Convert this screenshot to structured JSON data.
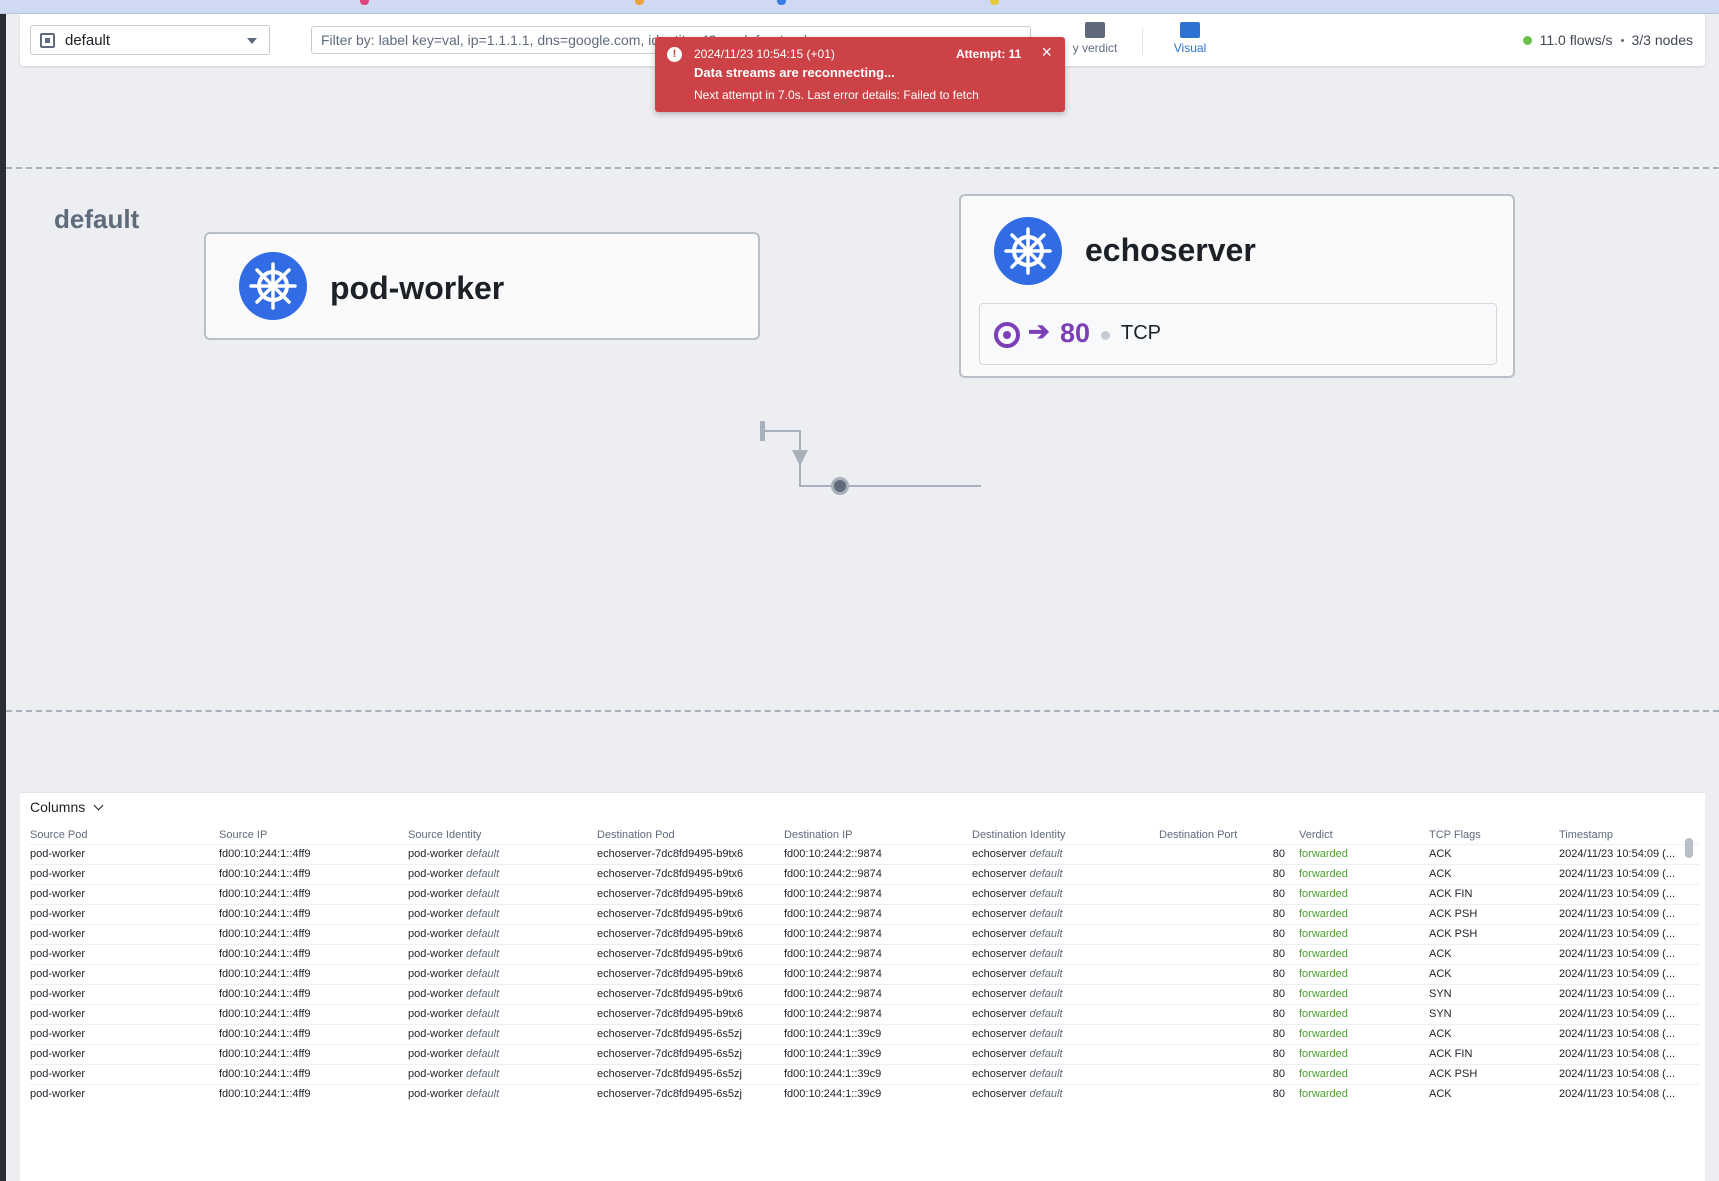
{
  "namespace_select": {
    "value": "default"
  },
  "filter": {
    "placeholder": "Filter by: label key=val, ip=1.1.1.1, dns=google.com, identity=42, pod=frontend"
  },
  "toolbar": {
    "verdict_label": "y verdict",
    "visual_label": "Visual"
  },
  "stats": {
    "flows": "11.0 flows/s",
    "nodes": "3/3 nodes"
  },
  "toast": {
    "timestamp": "2024/11/23 10:54:15 (+01)",
    "attempt": "Attempt: 11",
    "title": "Data streams are reconnecting...",
    "detail": "Next attempt in 7.0s. Last error details: Failed to fetch",
    "close": "×",
    "color": "#cd4246"
  },
  "canvas": {
    "namespace_title": "default",
    "source_card": {
      "name": "pod-worker",
      "icon": "kubernetes-icon"
    },
    "dest_card": {
      "name": "echoserver",
      "icon": "kubernetes-icon",
      "port": "80",
      "arrow": "➔",
      "protocol": "TCP",
      "accent": "#7c3fb8"
    }
  },
  "flows": {
    "columns_button": "Columns",
    "headers": [
      "Source Pod",
      "Source IP",
      "Source Identity",
      "Destination Pod",
      "Destination IP",
      "Destination Identity",
      "Destination Port",
      "Verdict",
      "TCP Flags",
      "Timestamp"
    ],
    "rows": [
      {
        "src_pod": "pod-worker",
        "src_ip": "fd00:10:244:1::4ff9",
        "src_id": "pod-worker",
        "src_ns": "default",
        "dst_pod": "echoserver-7dc8fd9495-b9tx6",
        "dst_ip": "fd00:10:244:2::9874",
        "dst_id": "echoserver",
        "dst_ns": "default",
        "port": "80",
        "verdict": "forwarded",
        "flags": "ACK",
        "ts": "2024/11/23 10:54:09 (..."
      },
      {
        "src_pod": "pod-worker",
        "src_ip": "fd00:10:244:1::4ff9",
        "src_id": "pod-worker",
        "src_ns": "default",
        "dst_pod": "echoserver-7dc8fd9495-b9tx6",
        "dst_ip": "fd00:10:244:2::9874",
        "dst_id": "echoserver",
        "dst_ns": "default",
        "port": "80",
        "verdict": "forwarded",
        "flags": "ACK",
        "ts": "2024/11/23 10:54:09 (..."
      },
      {
        "src_pod": "pod-worker",
        "src_ip": "fd00:10:244:1::4ff9",
        "src_id": "pod-worker",
        "src_ns": "default",
        "dst_pod": "echoserver-7dc8fd9495-b9tx6",
        "dst_ip": "fd00:10:244:2::9874",
        "dst_id": "echoserver",
        "dst_ns": "default",
        "port": "80",
        "verdict": "forwarded",
        "flags": "ACK FIN",
        "ts": "2024/11/23 10:54:09 (..."
      },
      {
        "src_pod": "pod-worker",
        "src_ip": "fd00:10:244:1::4ff9",
        "src_id": "pod-worker",
        "src_ns": "default",
        "dst_pod": "echoserver-7dc8fd9495-b9tx6",
        "dst_ip": "fd00:10:244:2::9874",
        "dst_id": "echoserver",
        "dst_ns": "default",
        "port": "80",
        "verdict": "forwarded",
        "flags": "ACK PSH",
        "ts": "2024/11/23 10:54:09 (..."
      },
      {
        "src_pod": "pod-worker",
        "src_ip": "fd00:10:244:1::4ff9",
        "src_id": "pod-worker",
        "src_ns": "default",
        "dst_pod": "echoserver-7dc8fd9495-b9tx6",
        "dst_ip": "fd00:10:244:2::9874",
        "dst_id": "echoserver",
        "dst_ns": "default",
        "port": "80",
        "verdict": "forwarded",
        "flags": "ACK PSH",
        "ts": "2024/11/23 10:54:09 (..."
      },
      {
        "src_pod": "pod-worker",
        "src_ip": "fd00:10:244:1::4ff9",
        "src_id": "pod-worker",
        "src_ns": "default",
        "dst_pod": "echoserver-7dc8fd9495-b9tx6",
        "dst_ip": "fd00:10:244:2::9874",
        "dst_id": "echoserver",
        "dst_ns": "default",
        "port": "80",
        "verdict": "forwarded",
        "flags": "ACK",
        "ts": "2024/11/23 10:54:09 (..."
      },
      {
        "src_pod": "pod-worker",
        "src_ip": "fd00:10:244:1::4ff9",
        "src_id": "pod-worker",
        "src_ns": "default",
        "dst_pod": "echoserver-7dc8fd9495-b9tx6",
        "dst_ip": "fd00:10:244:2::9874",
        "dst_id": "echoserver",
        "dst_ns": "default",
        "port": "80",
        "verdict": "forwarded",
        "flags": "ACK",
        "ts": "2024/11/23 10:54:09 (..."
      },
      {
        "src_pod": "pod-worker",
        "src_ip": "fd00:10:244:1::4ff9",
        "src_id": "pod-worker",
        "src_ns": "default",
        "dst_pod": "echoserver-7dc8fd9495-b9tx6",
        "dst_ip": "fd00:10:244:2::9874",
        "dst_id": "echoserver",
        "dst_ns": "default",
        "port": "80",
        "verdict": "forwarded",
        "flags": "SYN",
        "ts": "2024/11/23 10:54:09 (..."
      },
      {
        "src_pod": "pod-worker",
        "src_ip": "fd00:10:244:1::4ff9",
        "src_id": "pod-worker",
        "src_ns": "default",
        "dst_pod": "echoserver-7dc8fd9495-b9tx6",
        "dst_ip": "fd00:10:244:2::9874",
        "dst_id": "echoserver",
        "dst_ns": "default",
        "port": "80",
        "verdict": "forwarded",
        "flags": "SYN",
        "ts": "2024/11/23 10:54:09 (..."
      },
      {
        "src_pod": "pod-worker",
        "src_ip": "fd00:10:244:1::4ff9",
        "src_id": "pod-worker",
        "src_ns": "default",
        "dst_pod": "echoserver-7dc8fd9495-6s5zj",
        "dst_ip": "fd00:10:244:1::39c9",
        "dst_id": "echoserver",
        "dst_ns": "default",
        "port": "80",
        "verdict": "forwarded",
        "flags": "ACK",
        "ts": "2024/11/23 10:54:08 (..."
      },
      {
        "src_pod": "pod-worker",
        "src_ip": "fd00:10:244:1::4ff9",
        "src_id": "pod-worker",
        "src_ns": "default",
        "dst_pod": "echoserver-7dc8fd9495-6s5zj",
        "dst_ip": "fd00:10:244:1::39c9",
        "dst_id": "echoserver",
        "dst_ns": "default",
        "port": "80",
        "verdict": "forwarded",
        "flags": "ACK FIN",
        "ts": "2024/11/23 10:54:08 (..."
      },
      {
        "src_pod": "pod-worker",
        "src_ip": "fd00:10:244:1::4ff9",
        "src_id": "pod-worker",
        "src_ns": "default",
        "dst_pod": "echoserver-7dc8fd9495-6s5zj",
        "dst_ip": "fd00:10:244:1::39c9",
        "dst_id": "echoserver",
        "dst_ns": "default",
        "port": "80",
        "verdict": "forwarded",
        "flags": "ACK PSH",
        "ts": "2024/11/23 10:54:08 (..."
      },
      {
        "src_pod": "pod-worker",
        "src_ip": "fd00:10:244:1::4ff9",
        "src_id": "pod-worker",
        "src_ns": "default",
        "dst_pod": "echoserver-7dc8fd9495-6s5zj",
        "dst_ip": "fd00:10:244:1::39c9",
        "dst_id": "echoserver",
        "dst_ns": "default",
        "port": "80",
        "verdict": "forwarded",
        "flags": "ACK",
        "ts": "2024/11/23 10:54:08 (..."
      }
    ]
  },
  "colors": {
    "forwarded": "#4aa02c",
    "kubernetes_blue": "#326ce5",
    "accent_blue": "#2d72d2"
  }
}
